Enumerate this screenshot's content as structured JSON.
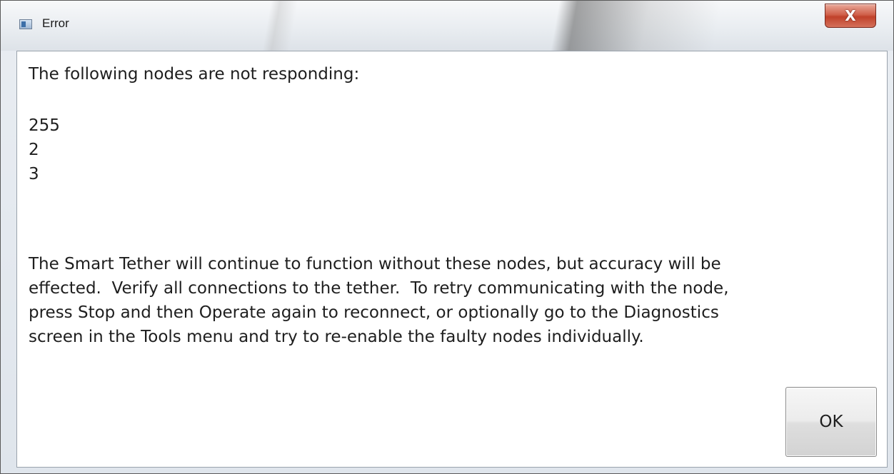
{
  "window": {
    "title": "Error",
    "close_label": "X"
  },
  "message": {
    "heading": "The following nodes are not responding:",
    "nodes": [
      "255",
      "2",
      "3"
    ],
    "body_lines": [
      "The Smart Tether will continue to function without these nodes, but accuracy will be",
      "effected.  Verify all connections to the tether.  To retry communicating with the node,",
      "press Stop and then Operate again to reconnect, or optionally go to the Diagnostics",
      "screen in the Tools menu and try to re-enable the faulty nodes individually."
    ]
  },
  "buttons": {
    "ok_label": "OK"
  },
  "colors": {
    "close_button": "#c9503a",
    "text": "#1e1e1e"
  },
  "icons": {
    "title": "window-app-icon",
    "close": "close-icon"
  }
}
